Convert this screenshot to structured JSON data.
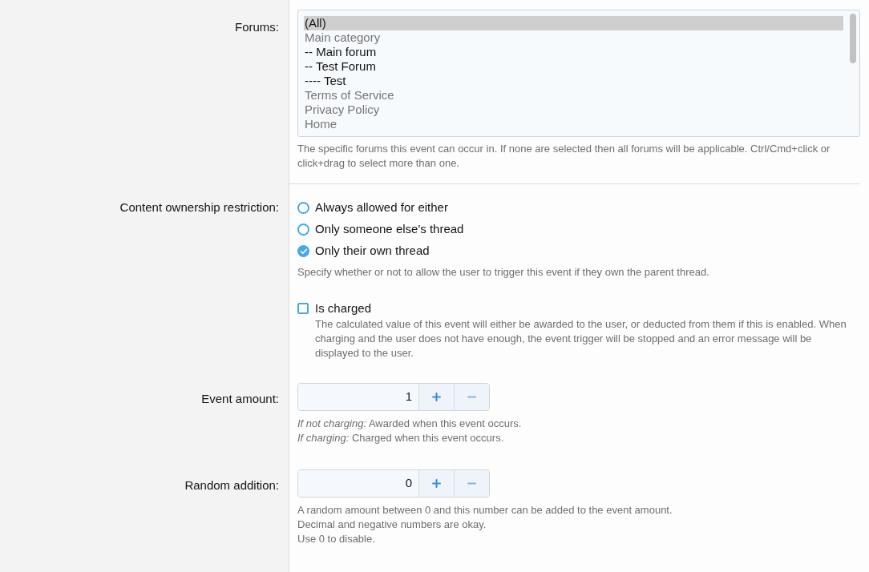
{
  "forums": {
    "label": "Forums:",
    "options": [
      {
        "text": "(All)",
        "kind": "forum",
        "selected": true
      },
      {
        "text": "Main category",
        "kind": "category",
        "selected": false
      },
      {
        "text": "-- Main forum",
        "kind": "forum",
        "selected": false
      },
      {
        "text": "-- Test Forum",
        "kind": "forum",
        "selected": false
      },
      {
        "text": "---- Test",
        "kind": "forum",
        "selected": false
      },
      {
        "text": "Terms of Service",
        "kind": "category",
        "selected": false
      },
      {
        "text": "Privacy Policy",
        "kind": "category",
        "selected": false
      },
      {
        "text": "Home",
        "kind": "category",
        "selected": false
      }
    ],
    "hint": "The specific forums this event can occur in. If none are selected then all forums will be applicable. Ctrl/Cmd+click or click+drag to select more than one."
  },
  "ownership": {
    "label": "Content ownership restriction:",
    "options": [
      {
        "text": "Always allowed for either",
        "selected": false
      },
      {
        "text": "Only someone else's thread",
        "selected": false
      },
      {
        "text": "Only their own thread",
        "selected": true
      }
    ],
    "hint": "Specify whether or not to allow the user to trigger this event if they own the parent thread."
  },
  "is_charged": {
    "label": "Is charged",
    "checked": false,
    "hint": "The calculated value of this event will either be awarded to the user, or deducted from them if this is enabled. When charging and the user does not have enough, the event trigger will be stopped and an error message will be displayed to the user."
  },
  "number_fields": [
    {
      "label": "Event amount:",
      "value": "1",
      "hints": [
        "*If not charging:* Awarded when this event occurs.",
        "*If charging:* Charged when this event occurs."
      ]
    },
    {
      "label": "Random addition:",
      "value": "0",
      "hints": [
        "A random amount between 0 and this number can be added to the event amount.",
        "Decimal and negative numbers are okay.",
        "Use 0 to disable."
      ]
    }
  ]
}
